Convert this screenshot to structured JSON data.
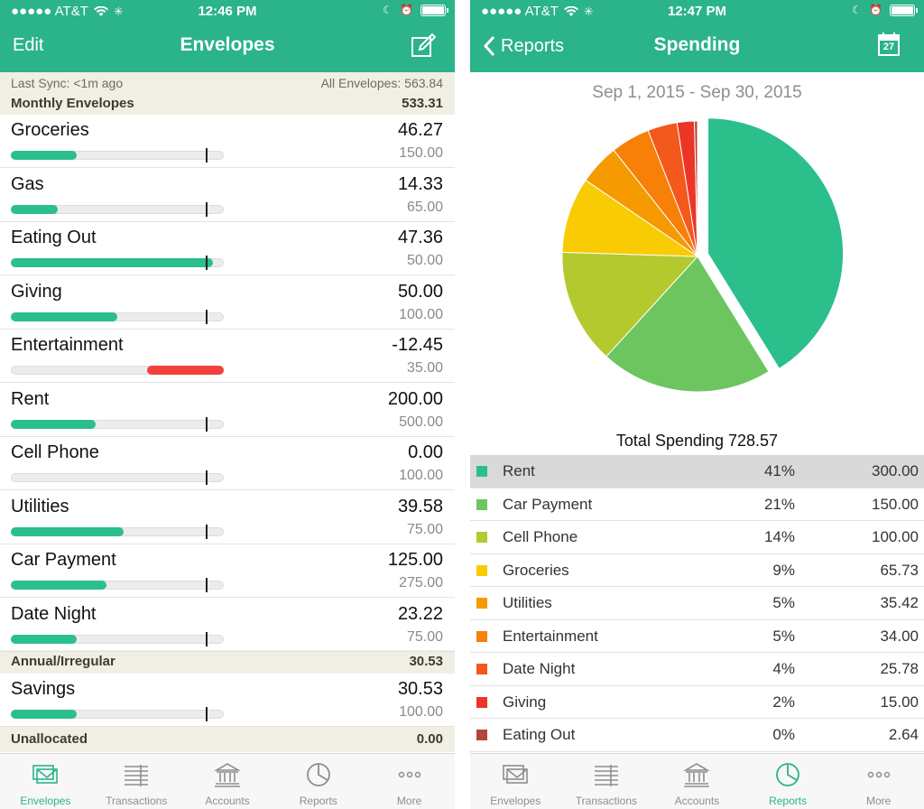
{
  "left": {
    "status": {
      "carrier": "●●●●● AT&T",
      "time": "12:46 PM"
    },
    "nav": {
      "left": "Edit",
      "title": "Envelopes"
    },
    "sync": {
      "last_sync": "Last Sync: <1m ago",
      "all_envelopes": "All Envelopes: 563.84"
    },
    "groups": [
      {
        "label": "Monthly Envelopes",
        "amount": "533.31"
      },
      {
        "label": "Annual/Irregular",
        "amount": "30.53"
      },
      {
        "label": "Unallocated",
        "amount": "0.00"
      }
    ],
    "envelopes": [
      {
        "name": "Groceries",
        "amount": "46.27",
        "budget": "150.00",
        "fill": 0.31,
        "over": false
      },
      {
        "name": "Gas",
        "amount": "14.33",
        "budget": "65.00",
        "fill": 0.22,
        "over": false
      },
      {
        "name": "Eating Out",
        "amount": "47.36",
        "budget": "50.00",
        "fill": 0.95,
        "over": false
      },
      {
        "name": "Giving",
        "amount": "50.00",
        "budget": "100.00",
        "fill": 0.5,
        "over": false
      },
      {
        "name": "Entertainment",
        "amount": "-12.45",
        "budget": "35.00",
        "fill": 0.36,
        "over": true
      },
      {
        "name": "Rent",
        "amount": "200.00",
        "budget": "500.00",
        "fill": 0.4,
        "over": false
      },
      {
        "name": "Cell Phone",
        "amount": "0.00",
        "budget": "100.00",
        "fill": 0.0,
        "over": false
      },
      {
        "name": "Utilities",
        "amount": "39.58",
        "budget": "75.00",
        "fill": 0.53,
        "over": false
      },
      {
        "name": "Car Payment",
        "amount": "125.00",
        "budget": "275.00",
        "fill": 0.45,
        "over": false
      },
      {
        "name": "Date Night",
        "amount": "23.22",
        "budget": "75.00",
        "fill": 0.31,
        "over": false
      },
      {
        "name": "Savings",
        "amount": "30.53",
        "budget": "100.00",
        "fill": 0.31,
        "over": false
      }
    ]
  },
  "right": {
    "status": {
      "carrier": "●●●●● AT&T",
      "time": "12:47 PM"
    },
    "nav": {
      "back": "Reports",
      "title": "Spending",
      "calendar_day": "27"
    },
    "date_range": "Sep 1, 2015 - Sep 30, 2015",
    "total": "Total Spending 728.57",
    "legend": [
      {
        "name": "Rent",
        "pct": "41%",
        "value": "300.00",
        "color": "#2bbf8c"
      },
      {
        "name": "Car Payment",
        "pct": "21%",
        "value": "150.00",
        "color": "#6cc55f"
      },
      {
        "name": "Cell Phone",
        "pct": "14%",
        "value": "100.00",
        "color": "#b3c92e"
      },
      {
        "name": "Groceries",
        "pct": "9%",
        "value": "65.73",
        "color": "#f8cb02"
      },
      {
        "name": "Utilities",
        "pct": "5%",
        "value": "35.42",
        "color": "#f59a00"
      },
      {
        "name": "Entertainment",
        "pct": "5%",
        "value": "34.00",
        "color": "#f68008"
      },
      {
        "name": "Date Night",
        "pct": "4%",
        "value": "25.78",
        "color": "#f3591c"
      },
      {
        "name": "Giving",
        "pct": "2%",
        "value": "15.00",
        "color": "#ec3527"
      },
      {
        "name": "Eating Out",
        "pct": "0%",
        "value": "2.64",
        "color": "#b4453a"
      }
    ]
  },
  "tabs": [
    {
      "label": "Envelopes",
      "icon": "envelopes-icon"
    },
    {
      "label": "Transactions",
      "icon": "transactions-icon"
    },
    {
      "label": "Accounts",
      "icon": "bank-icon"
    },
    {
      "label": "Reports",
      "icon": "pie-chart-icon"
    },
    {
      "label": "More",
      "icon": "more-icon"
    }
  ],
  "colors": {
    "accent": "#2bb38a",
    "bar_fill": "#2bbf8c",
    "bar_over": "#f2413c",
    "group_bg": "#f1efe3"
  },
  "chart_data": {
    "type": "pie",
    "categories": [
      "Rent",
      "Car Payment",
      "Cell Phone",
      "Groceries",
      "Utilities",
      "Entertainment",
      "Date Night",
      "Giving",
      "Eating Out"
    ],
    "values": [
      300.0,
      150.0,
      100.0,
      65.73,
      35.42,
      34.0,
      25.78,
      15.0,
      2.64
    ],
    "title": "Total Spending 728.57"
  }
}
